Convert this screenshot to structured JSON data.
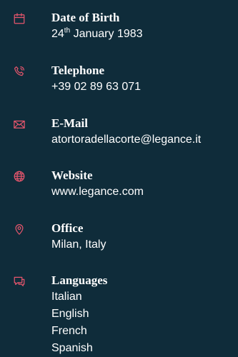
{
  "colors": {
    "background": "#0f2c3a",
    "accent": "#e8566d",
    "text": "#ffffff"
  },
  "items": [
    {
      "icon": "calendar-icon",
      "title": "Date of Birth",
      "value_day": "24",
      "value_suffix": "th",
      "value_rest": " January 1983"
    },
    {
      "icon": "phone-icon",
      "title": "Telephone",
      "value": "+39 02 89 63 071"
    },
    {
      "icon": "mail-icon",
      "title": "E-Mail",
      "value": "atortoradellacorte@legance.it"
    },
    {
      "icon": "globe-icon",
      "title": "Website",
      "value": "www.legance.com"
    },
    {
      "icon": "location-pin-icon",
      "title": "Office",
      "value": "Milan, Italy"
    },
    {
      "icon": "chat-icon",
      "title": "Languages",
      "languages": [
        "Italian",
        "English",
        "French",
        "Spanish"
      ]
    }
  ]
}
